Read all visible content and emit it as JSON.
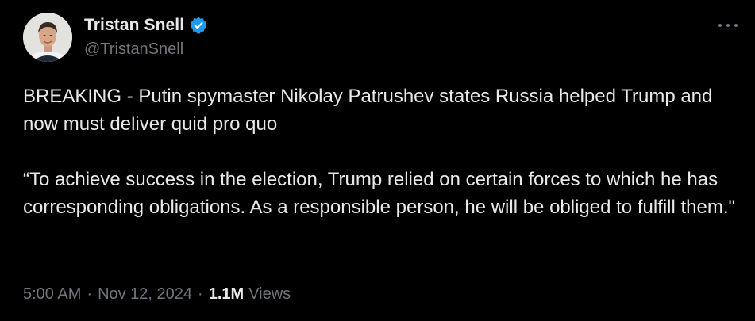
{
  "author": {
    "display_name": "Tristan Snell",
    "handle": "@TristanSnell",
    "verified": true,
    "verified_color": "#1d9bf0"
  },
  "tweet": {
    "paragraphs": [
      "BREAKING - Putin spymaster Nikolay Patrushev states Russia helped Trump and now must deliver quid pro quo",
      "“To achieve success in the election, Trump relied on certain forces to which he has corresponding obligations. As a responsible person, he will be obliged to fulfill them.\""
    ],
    "time": "5:00 AM",
    "separator": "·",
    "date": "Nov 12, 2024",
    "views_count": "1.1M",
    "views_label": "Views"
  },
  "icons": {
    "avatar": "avatar-photo",
    "verified": "verified-badge-icon",
    "more": "more-options-icon"
  },
  "colors": {
    "background": "#000000",
    "text_primary": "#e7e9ea",
    "text_secondary": "#71767b"
  }
}
